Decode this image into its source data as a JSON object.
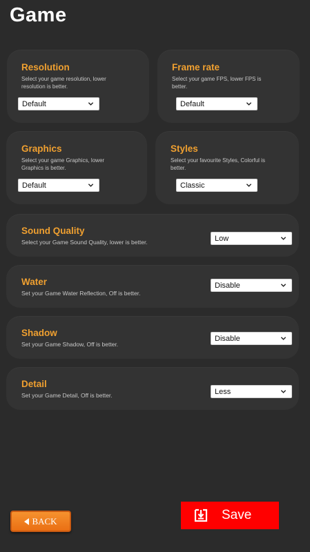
{
  "page": {
    "title": "Game"
  },
  "colors": {
    "background": "#2b2b2b",
    "card": "#333333",
    "accent": "#f0a030",
    "save": "#ff0000",
    "back": "#f07a20"
  },
  "settings": {
    "resolution": {
      "title": "Resolution",
      "desc1": "Select your game resolution, lower",
      "desc2": "resolution is better.",
      "value": "Default"
    },
    "framerate": {
      "title": "Frame rate",
      "desc1": "Select your game FPS, lower FPS is",
      "desc2": "better.",
      "value": "Default"
    },
    "graphics": {
      "title": "Graphics",
      "desc1": "Select your game Graphics, lower",
      "desc2": "Graphics is better.",
      "value": "Default"
    },
    "styles": {
      "title": "Styles",
      "desc1": "Select your favourite Styles, Colorful  is",
      "desc2": "better.",
      "value": "Classic"
    },
    "sound": {
      "title": "Sound Quality",
      "desc": "Select your Game Sound Quality, lower  is better.",
      "value": "Low"
    },
    "water": {
      "title": "Water",
      "desc": "Set your Game Water Reflection, Off  is better.",
      "value": "Disable"
    },
    "shadow": {
      "title": "Shadow",
      "desc": "Set your Game Shadow, Off  is better.",
      "value": "Disable"
    },
    "detail": {
      "title": "Detail",
      "desc": "Set your Game Detail, Off  is better.",
      "value": "Less"
    }
  },
  "buttons": {
    "back_label": "BACK",
    "save_label": "Save"
  },
  "icons": {
    "back": "left-triangle-icon",
    "save": "save-download-icon",
    "dropdown": "chevron-down-icon"
  }
}
